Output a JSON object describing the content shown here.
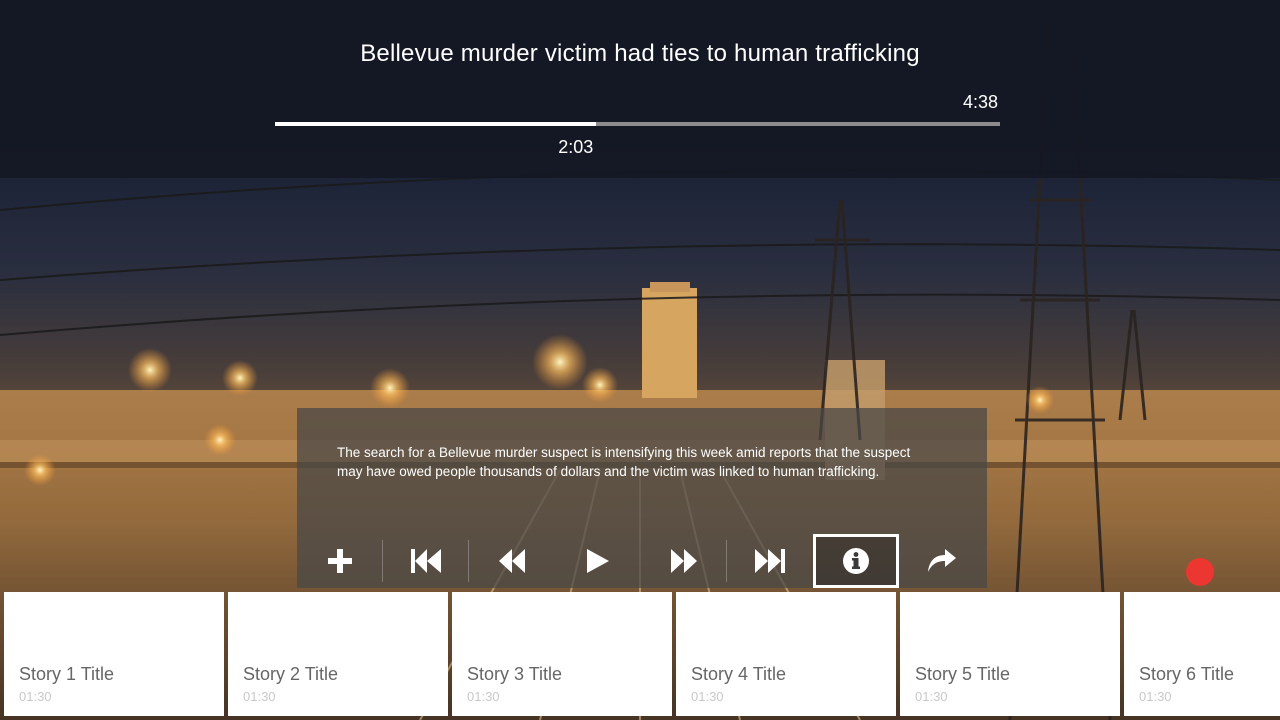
{
  "player": {
    "title": "Bellevue murder victim had ties to human trafficking",
    "duration": "4:38",
    "elapsed": "2:03",
    "progress_fraction": 0.4424,
    "description": "The search for a Bellevue murder suspect is intensifying this week amid reports that the suspect may have owed people thousands of dollars and the victim was linked to human trafficking."
  },
  "controls": [
    {
      "name": "add-button",
      "icon": "plus-icon"
    },
    {
      "name": "skip-previous-button",
      "icon": "skip-previous-icon"
    },
    {
      "name": "rewind-button",
      "icon": "rewind-icon"
    },
    {
      "name": "play-button",
      "icon": "play-icon"
    },
    {
      "name": "fast-forward-button",
      "icon": "fast-forward-icon"
    },
    {
      "name": "skip-next-button",
      "icon": "skip-next-icon"
    },
    {
      "name": "info-button",
      "icon": "info-icon",
      "focused": true
    },
    {
      "name": "share-button",
      "icon": "share-icon"
    }
  ],
  "stories": [
    {
      "title": "Story 1 Title",
      "duration": "01:30"
    },
    {
      "title": "Story 2 Title",
      "duration": "01:30"
    },
    {
      "title": "Story 3 Title",
      "duration": "01:30"
    },
    {
      "title": "Story 4 Title",
      "duration": "01:30"
    },
    {
      "title": "Story 5 Title",
      "duration": "01:30"
    },
    {
      "title": "Story 6 Title",
      "duration": "01:30"
    }
  ],
  "colors": {
    "topbar": "#141824",
    "progress_fill": "#ffffff",
    "progress_track": "#8c8c8c",
    "focus_border": "#ffffff"
  }
}
